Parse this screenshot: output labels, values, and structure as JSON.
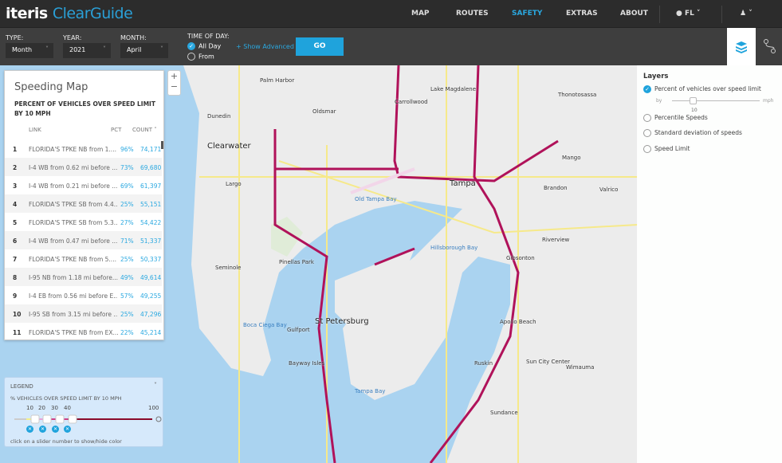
{
  "header": {
    "logo_brand": "iteris",
    "logo_product": "ClearGuide",
    "nav": [
      "MAP",
      "ROUTES",
      "SAFETY",
      "EXTRAS",
      "ABOUT"
    ],
    "active_nav": "SAFETY",
    "region": "FL",
    "accent": "#2aa8e0"
  },
  "toolbar": {
    "type_label": "TYPE:",
    "type_value": "Month",
    "year_label": "YEAR:",
    "year_value": "2021",
    "month_label": "MONTH:",
    "month_value": "April",
    "time_label": "TIME OF DAY:",
    "all_day": "All Day",
    "from": "From",
    "time_selected": "All Day",
    "show_advanced": "+ Show Advanced",
    "go": "GO"
  },
  "table_panel": {
    "title": "Speeding Map",
    "subtitle": "PERCENT OF VEHICLES OVER SPEED LIMIT BY 10 MPH",
    "columns": [
      "LINK",
      "PCT",
      "COUNT"
    ],
    "sort_column": "COUNT",
    "rows": [
      {
        "n": "1",
        "link": "FLORIDA'S TPKE NB from 1....",
        "pct": "96%",
        "count": "74,171"
      },
      {
        "n": "2",
        "link": "I-4 WB from 0.62 mi before ...",
        "pct": "73%",
        "count": "69,680"
      },
      {
        "n": "3",
        "link": "I-4 WB from 0.21 mi before ...",
        "pct": "69%",
        "count": "61,397"
      },
      {
        "n": "4",
        "link": "FLORIDA'S TPKE SB from 4.4...",
        "pct": "25%",
        "count": "55,151"
      },
      {
        "n": "5",
        "link": "FLORIDA'S TPKE SB from 5.3...",
        "pct": "27%",
        "count": "54,422"
      },
      {
        "n": "6",
        "link": "I-4 WB from 0.47 mi before ...",
        "pct": "71%",
        "count": "51,337"
      },
      {
        "n": "7",
        "link": "FLORIDA'S TPKE NB from 5....",
        "pct": "25%",
        "count": "50,337"
      },
      {
        "n": "8",
        "link": "I-95 NB from 1.18 mi before...",
        "pct": "49%",
        "count": "49,614"
      },
      {
        "n": "9",
        "link": "I-4 EB from 0.56 mi before E...",
        "pct": "57%",
        "count": "49,255"
      },
      {
        "n": "10",
        "link": "I-95 SB from 3.15 mi before ...",
        "pct": "25%",
        "count": "47,296"
      },
      {
        "n": "11",
        "link": "FLORIDA'S TPKE NB from EX...",
        "pct": "22%",
        "count": "45,214"
      }
    ]
  },
  "zoom": {
    "in": "+",
    "out": "−"
  },
  "legend": {
    "title": "LEGEND",
    "subtitle": "% VEHICLES OVER SPEED LIMIT BY 10 MPH",
    "stops": [
      "10",
      "20",
      "30",
      "40"
    ],
    "max": "100",
    "hint": "click on a slider number to show/hide color",
    "colors": [
      "#cccccc",
      "#f4f08a",
      "#e8a0d8",
      "#d0408a",
      "#8a0a2a"
    ]
  },
  "layers": {
    "title": "Layers",
    "options": [
      "Percent of vehicles over speed limit",
      "Percentile Speeds",
      "Standard deviation of speeds",
      "Speed Limit"
    ],
    "selected": "Percent of vehicles over speed limit",
    "by": "by",
    "mph": "mph",
    "threshold": "10"
  },
  "map_labels": {
    "tampa": "Tampa",
    "st_pete": "St Petersburg",
    "clearwater": "Clearwater",
    "brandon": "Brandon",
    "largo": "Largo",
    "pinellas": "Pinellas Park",
    "dunedin": "Dunedin",
    "oldsmar": "Oldsmar",
    "palm_harbor": "Palm Harbor",
    "riverview": "Riverview",
    "ruskin": "Ruskin",
    "apollo": "Apollo Beach",
    "gibsonton": "Gibsonton",
    "sun_city": "Sun City Center",
    "tampa_bay": "Tampa Bay",
    "old_tampa_bay": "Old Tampa Bay",
    "hillsborough_bay": "Hillsborough Bay",
    "boca_ciega": "Boca Ciega Bay",
    "seminole": "Seminole",
    "carrollwood": "Carrollwood",
    "lutz": "Lake Magdalene",
    "thonotosassa": "Thonotosassa",
    "valrico": "Valrico",
    "mango": "Mango",
    "wimauma": "Wimauma",
    "sundance": "Sundance",
    "gulfport": "Gulfport",
    "st_pete_beach": "Bayway Isles"
  }
}
